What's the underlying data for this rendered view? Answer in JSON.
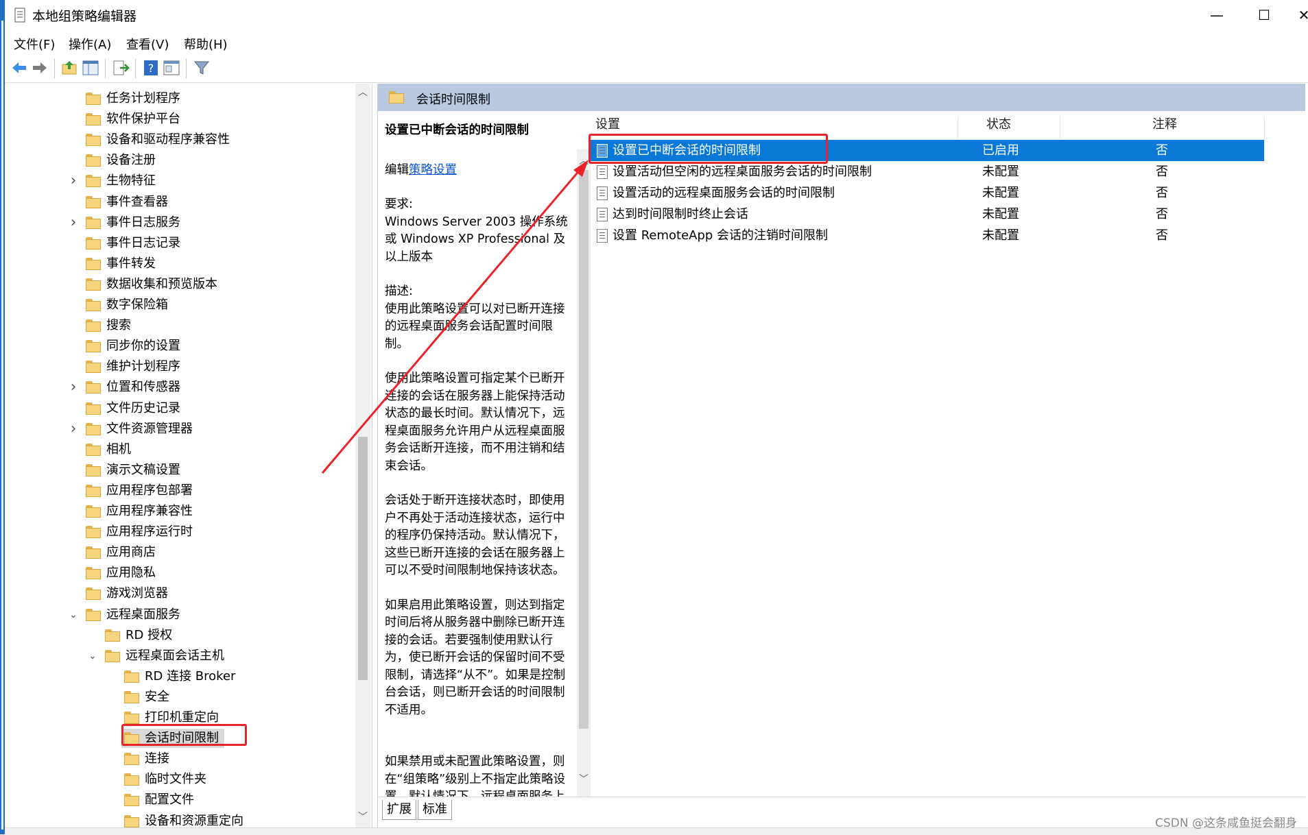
{
  "window": {
    "title": "本地组策略编辑器",
    "minimize": "—",
    "maximize": "☐",
    "close": "✕"
  },
  "menu": [
    "文件(F)",
    "操作(A)",
    "查看(V)",
    "帮助(H)"
  ],
  "toolbar_icons": [
    "back-icon",
    "forward-icon",
    "up-folder-icon",
    "show-hide-tree-icon",
    "export-list-icon",
    "help-icon",
    "properties-icon",
    "filter-icon"
  ],
  "tree": {
    "items": [
      {
        "label": "任务计划程序",
        "expandable": false
      },
      {
        "label": "软件保护平台",
        "expandable": false
      },
      {
        "label": "设备和驱动程序兼容性",
        "expandable": false
      },
      {
        "label": "设备注册",
        "expandable": false
      },
      {
        "label": "生物特征",
        "expandable": true
      },
      {
        "label": "事件查看器",
        "expandable": false
      },
      {
        "label": "事件日志服务",
        "expandable": true
      },
      {
        "label": "事件日志记录",
        "expandable": false
      },
      {
        "label": "事件转发",
        "expandable": false
      },
      {
        "label": "数据收集和预览版本",
        "expandable": false
      },
      {
        "label": "数字保险箱",
        "expandable": false
      },
      {
        "label": "搜索",
        "expandable": false
      },
      {
        "label": "同步你的设置",
        "expandable": false
      },
      {
        "label": "维护计划程序",
        "expandable": false
      },
      {
        "label": "位置和传感器",
        "expandable": true
      },
      {
        "label": "文件历史记录",
        "expandable": false
      },
      {
        "label": "文件资源管理器",
        "expandable": true
      },
      {
        "label": "相机",
        "expandable": false
      },
      {
        "label": "演示文稿设置",
        "expandable": false
      },
      {
        "label": "应用程序包部署",
        "expandable": false
      },
      {
        "label": "应用程序兼容性",
        "expandable": false
      },
      {
        "label": "应用程序运行时",
        "expandable": false
      },
      {
        "label": "应用商店",
        "expandable": false
      },
      {
        "label": "应用隐私",
        "expandable": false
      },
      {
        "label": "游戏浏览器",
        "expandable": false
      },
      {
        "label": "远程桌面服务",
        "expandable": "open"
      },
      {
        "label": "RD 授权",
        "expandable": false
      },
      {
        "label": "远程桌面会话主机",
        "expandable": "open"
      },
      {
        "label": "RD 连接 Broker",
        "expandable": false
      },
      {
        "label": "安全",
        "expandable": false
      },
      {
        "label": "打印机重定向",
        "expandable": false
      },
      {
        "label": "会话时间限制",
        "expandable": false,
        "selected": true
      },
      {
        "label": "连接",
        "expandable": false
      },
      {
        "label": "临时文件夹",
        "expandable": false
      },
      {
        "label": "配置文件",
        "expandable": false
      },
      {
        "label": "设备和资源重定向",
        "expandable": false
      }
    ]
  },
  "right": {
    "header_title": "会话时间限制",
    "description": {
      "heading": "设置已中断会话的时间限制",
      "edit_prefix": "编辑",
      "edit_link": "策略设置",
      "req_title": "要求:",
      "req_text": "Windows Server 2003 操作系统或 Windows XP Professional 及以上版本",
      "desc_title": "描述:",
      "p1": "使用此策略设置可以对已断开连接的远程桌面服务会话配置时间限制。",
      "p2": "使用此策略设置可指定某个已断开连接的会话在服务器上能保持活动状态的最长时间。默认情况下，远程桌面服务允许用户从远程桌面服务会话断开连接，而不用注销和结束会话。",
      "p3": "会话处于断开连接状态时，即使用户不再处于活动连接状态，运行中的程序仍保持活动。默认情况下，这些已断开连接的会话在服务器上可以不受时间限制地保持该状态。",
      "p4": "如果启用此策略设置，则达到指定时间后将从服务器中删除已断开连接的会话。若要强制使用默认行为，使已断开会话的保留时间不受限制，请选择“从不”。如果是控制台会话，则已断开会话的时间限制不适用。",
      "p5": "如果禁用或未配置此策略设置，则在“组策略”级别上不指定此策略设置。默认情况下，远程桌面服务上"
    },
    "columns": {
      "setting": "设置",
      "state": "状态",
      "comment": "注释"
    },
    "rows": [
      {
        "setting": "设置已中断会话的时间限制",
        "state": "已启用",
        "comment": "否",
        "selected": true
      },
      {
        "setting": "设置活动但空闲的远程桌面服务会话的时间限制",
        "state": "未配置",
        "comment": "否"
      },
      {
        "setting": "设置活动的远程桌面服务会话的时间限制",
        "state": "未配置",
        "comment": "否"
      },
      {
        "setting": "达到时间限制时终止会话",
        "state": "未配置",
        "comment": "否"
      },
      {
        "setting": "设置 RemoteApp 会话的注销时间限制",
        "state": "未配置",
        "comment": "否"
      }
    ],
    "tabs": [
      "扩展",
      "标准"
    ]
  },
  "watermark": "CSDN @这条咸鱼挺会翻身",
  "colors": {
    "selection": "#0a78d7",
    "header_band": "#b9c9e0",
    "annotation_red": "#e8232a"
  }
}
